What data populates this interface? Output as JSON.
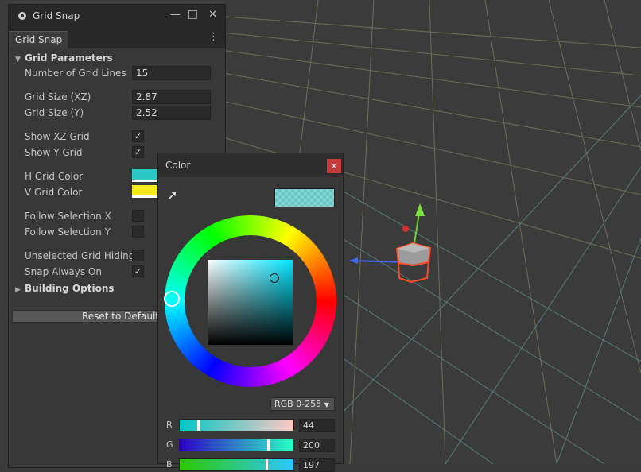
{
  "window": {
    "title": "Grid Snap",
    "tab": "Grid Snap"
  },
  "grid_parameters": {
    "header": "Grid Parameters",
    "number_of_grid_lines": {
      "label": "Number of Grid Lines",
      "value": "15"
    },
    "grid_size_xz": {
      "label": "Grid Size (XZ)",
      "value": "2.87"
    },
    "grid_size_y": {
      "label": "Grid Size (Y)",
      "value": "2.52"
    },
    "show_xz_grid": {
      "label": "Show XZ Grid",
      "checked": true
    },
    "show_y_grid": {
      "label": "Show Y Grid",
      "checked": true
    },
    "h_grid_color": {
      "label": "H Grid Color",
      "color": "#2cc8c5"
    },
    "v_grid_color": {
      "label": "V Grid Color",
      "color": "#f5ea1c"
    },
    "follow_selection_x": {
      "label": "Follow Selection X",
      "checked": false
    },
    "follow_selection_y": {
      "label": "Follow Selection Y",
      "checked": false
    },
    "unselected_grid_hiding": {
      "label": "Unselected Grid Hiding",
      "checked": false
    },
    "snap_always_on": {
      "label": "Snap Always On",
      "checked": true
    }
  },
  "building_options": {
    "header": "Building Options"
  },
  "reset_button": "Reset to Default",
  "color_picker": {
    "title": "Color",
    "close_label": "x",
    "mode": "RGB 0-255",
    "preview_color": "#2cc8c5",
    "channels": [
      {
        "label": "R",
        "value": "44",
        "fraction": 0.17
      },
      {
        "label": "G",
        "value": "200",
        "fraction": 0.78
      },
      {
        "label": "B",
        "value": "197",
        "fraction": 0.77
      }
    ]
  },
  "icons": {
    "window": "unity-cog-icon",
    "picker": "eyedropper-icon"
  }
}
